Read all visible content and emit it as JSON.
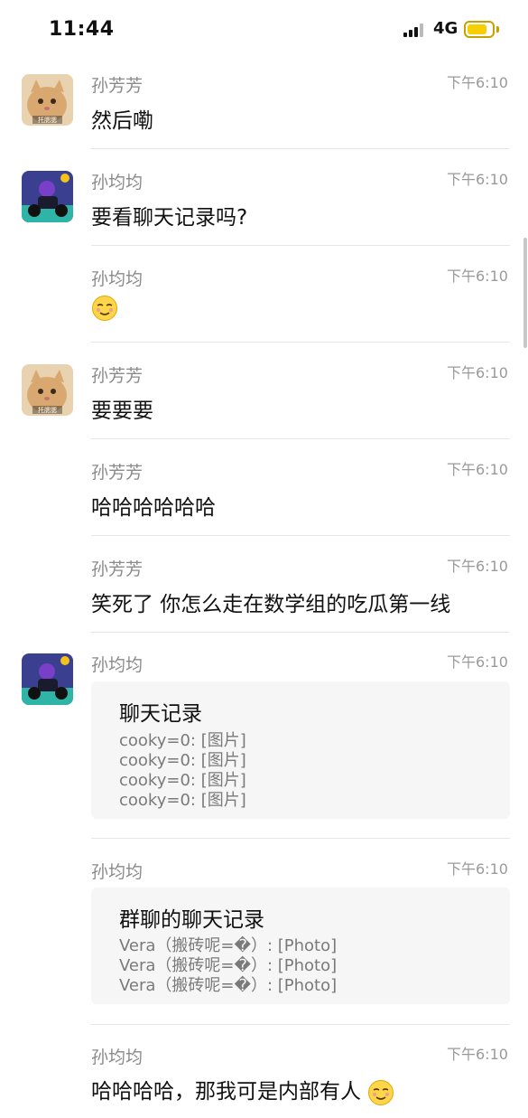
{
  "status_bar": {
    "time": "11:44",
    "network": "4G",
    "battery_level": 0.8
  },
  "messages": [
    {
      "sender": "孙芳芳",
      "time": "下午6:10",
      "text": "然后嘞",
      "avatar_label": "托腮腮"
    },
    {
      "sender": "孙均均",
      "time": "下午6:10",
      "text": "要看聊天记录吗?"
    },
    {
      "sender": "孙均均",
      "time": "下午6:10",
      "emoji": "smirk-emoji"
    },
    {
      "sender": "孙芳芳",
      "time": "下午6:10",
      "text": "要要要",
      "avatar_label": "托腮腮"
    },
    {
      "sender": "孙芳芳",
      "time": "下午6:10",
      "text": "哈哈哈哈哈哈"
    },
    {
      "sender": "孙芳芳",
      "time": "下午6:10",
      "text": "笑死了 你怎么走在数学组的吃瓜第一线"
    },
    {
      "sender": "孙均均",
      "time": "下午6:10",
      "card": {
        "title": "聊天记录",
        "lines": [
          "cooky=0: [图片]",
          "cooky=0: [图片]",
          "cooky=0: [图片]",
          "cooky=0: [图片]"
        ]
      }
    },
    {
      "sender": "孙均均",
      "time": "下午6:10",
      "card": {
        "title": "群聊的聊天记录",
        "lines": [
          "Vera（搬砖呢=�）: [Photo]",
          "Vera（搬砖呢=�）: [Photo]",
          "Vera（搬砖呢=�）: [Photo]"
        ]
      }
    },
    {
      "sender": "孙均均",
      "time": "下午6:10",
      "text": "哈哈哈哈，那我可是内部有人",
      "emoji": "smirk-emoji"
    }
  ],
  "colors": {
    "cat_avatar": "#d9a871",
    "bike_avatar": "#3a3f8f",
    "card_bg": "#f6f6f6",
    "battery": "#f7cf00"
  }
}
